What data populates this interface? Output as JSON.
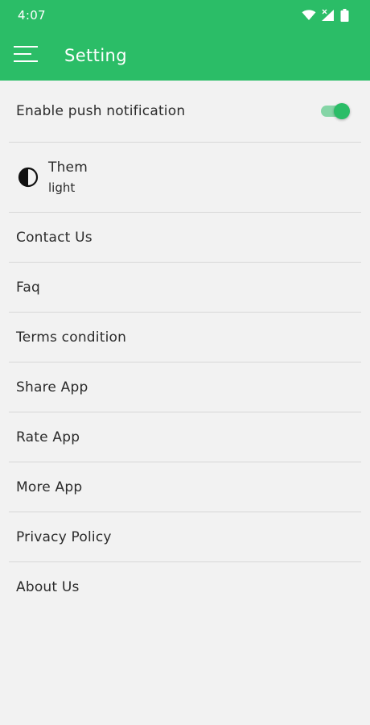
{
  "status_bar": {
    "time": "4:07",
    "icons": [
      "wifi-icon",
      "cell-signal-icon",
      "battery-icon"
    ]
  },
  "app_bar": {
    "title": "Setting",
    "menu_icon": "hamburger-menu-icon"
  },
  "settings": {
    "push": {
      "label": "Enable push notification",
      "enabled": true
    },
    "theme": {
      "label": "Them",
      "value": "light",
      "icon": "contrast-icon"
    },
    "items": [
      {
        "label": "Contact Us"
      },
      {
        "label": "Faq"
      },
      {
        "label": "Terms condition"
      },
      {
        "label": "Share App"
      },
      {
        "label": "Rate App"
      },
      {
        "label": "More App"
      },
      {
        "label": "Privacy Policy"
      },
      {
        "label": "About Us"
      }
    ]
  },
  "colors": {
    "primary": "#2bbd67",
    "background": "#f2f2f2",
    "divider": "#d7d7d7",
    "text": "#2b2b2b"
  }
}
